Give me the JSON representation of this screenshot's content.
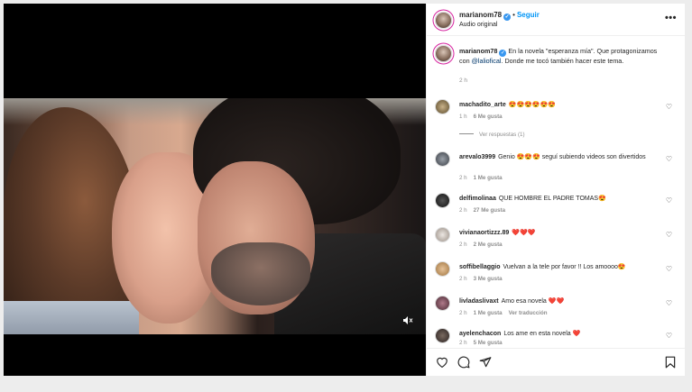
{
  "post": {
    "username": "marianom78",
    "separator": "•",
    "follow_label": "Seguir",
    "audio": "Audio original",
    "caption_user": "marianom78",
    "caption_text_1": "En la novela \"esperanza mía\". Que protagonizamos con",
    "caption_mention": "@laliofical",
    "caption_text_2": ". Donde me tocó también hacer este tema.",
    "caption_time": "2 h"
  },
  "comments": [
    {
      "user": "machadito_arte",
      "text": "😍😍😍😍😍😍",
      "time": "1 h",
      "likes": "6 Me gusta",
      "replies": "Ver respuestas (1)"
    },
    {
      "user": "arevalo3999",
      "text": "Genio 😍😍😍 seguí subiendo videos son divertidos",
      "time": "2 h",
      "likes": "1 Me gusta"
    },
    {
      "user": "delfimolinaa",
      "text": "QUE HOMBRE EL PADRE TOMAS😍",
      "time": "2 h",
      "likes": "27 Me gusta"
    },
    {
      "user": "vivianaortizzz.89",
      "text": "❤️❤️❤️",
      "time": "2 h",
      "likes": "2 Me gusta"
    },
    {
      "user": "soffibellaggio",
      "text": "Vuelvan a la tele por favor !! Los amoooo😍",
      "time": "2 h",
      "likes": "3 Me gusta"
    },
    {
      "user": "livladaslivaxt",
      "text": "Amo esa novela ❤️❤️",
      "time": "2 h",
      "likes": "1 Me gusta",
      "translate": "Ver traducción"
    },
    {
      "user": "ayelenchacon",
      "text": "Los ame en esta novela ❤️",
      "time": "2 h",
      "likes": "5 Me gusta"
    }
  ],
  "icons": {
    "more": "more-options-icon",
    "like": "heart-icon",
    "comment": "comment-icon",
    "share": "share-icon",
    "save": "bookmark-icon",
    "sound": "speaker-icon"
  },
  "colors": {
    "accent": "#0095f6",
    "verified": "#3897f0",
    "muted": "#8e8e8e"
  }
}
